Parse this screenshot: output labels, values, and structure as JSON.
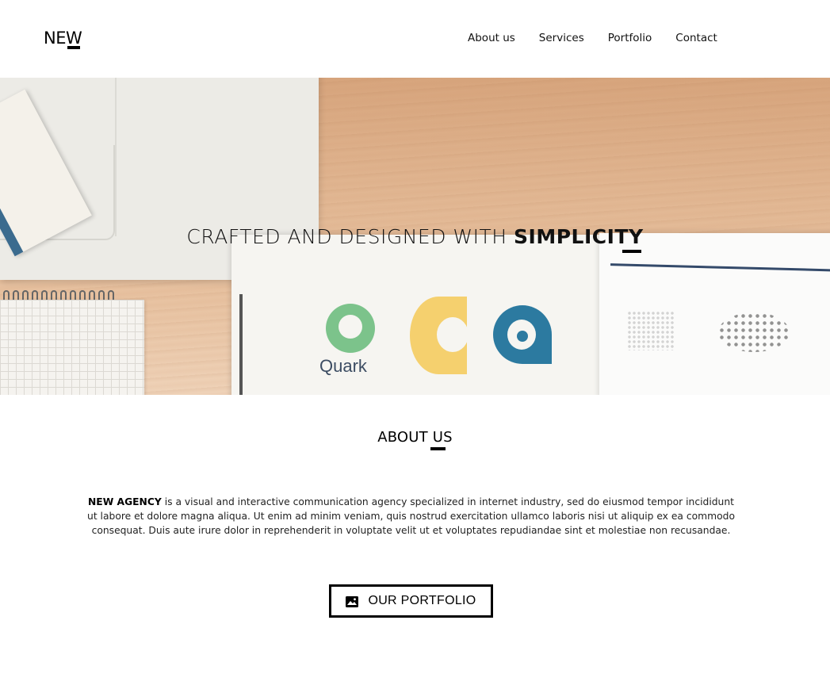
{
  "header": {
    "logo_prefix": "NE",
    "logo_underlined": "W",
    "nav": [
      {
        "label": "About us"
      },
      {
        "label": "Services"
      },
      {
        "label": "Portfolio"
      },
      {
        "label": "Contact"
      }
    ]
  },
  "hero": {
    "title_prefix": "CRAFTED AND DESIGNED WITH ",
    "title_emphasis": "SIMPLICITY",
    "quark_label": "Quark"
  },
  "about": {
    "title": "ABOUT US",
    "company": "NEW AGENCY",
    "text": " is a visual and interactive communication agency specialized in internet industry, sed do eiusmod tempor incididunt ut labore et dolore magna aliqua. Ut enim ad minim veniam, quis nostrud exercitation ullamco laboris nisi ut aliquip ex ea commodo consequat. Duis aute irure dolor in reprehenderit in voluptate velit ut et voluptates repudiandae sint et molestiae non recusandae."
  },
  "portfolio_button": {
    "label": "OUR PORTFOLIO",
    "icon": "image-icon"
  }
}
